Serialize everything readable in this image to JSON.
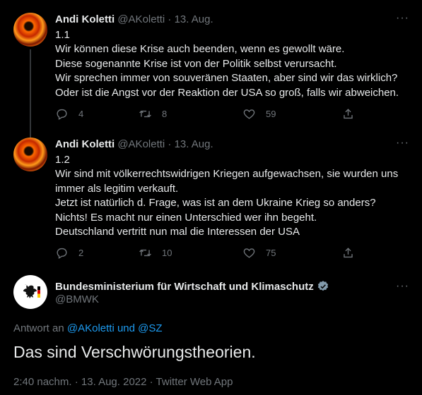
{
  "tweets": [
    {
      "name": "Andi Koletti",
      "handle": "@AKoletti",
      "sep": " · ",
      "date": "13. Aug.",
      "lines": [
        "1.1",
        "Wir können diese Krise auch beenden, wenn es gewollt wäre.",
        "Diese sogenannte Krise ist von der Politik selbst verursacht.",
        "Wir sprechen immer von souveränen Staaten, aber sind wir das wirklich?",
        "Oder ist die Angst vor der Reaktion der USA so groß, falls wir abweichen."
      ],
      "replies": "4",
      "retweets": "8",
      "likes": "59"
    },
    {
      "name": "Andi Koletti",
      "handle": "@AKoletti",
      "sep": " · ",
      "date": "13. Aug.",
      "lines": [
        "1.2",
        "Wir sind mit völkerrechtswidrigen Kriegen aufgewachsen, sie wurden uns",
        "immer als legitim verkauft.",
        "Jetzt ist natürlich d. Frage, was ist an dem Ukraine Krieg so anders?",
        "Nichts! Es macht nur einen Unterschied wer ihn begeht.",
        "Deutschland vertritt nun mal die Interessen der USA"
      ],
      "replies": "2",
      "retweets": "10",
      "likes": "75"
    }
  ],
  "main": {
    "name": "Bundesministerium für Wirtschaft und Klimaschutz",
    "handle": "@BMWK",
    "reply_prefix": "Antwort an ",
    "reply_user1": "@AKoletti",
    "reply_and": " und ",
    "reply_user2": "@SZ",
    "text": "Das sind Verschwörungstheorien.",
    "timestamp": "2:40 nachm. · 13. Aug. 2022 · Twitter Web App"
  },
  "more_label": "···",
  "colors": {
    "background": "#000000",
    "text": "#e7e9ea",
    "muted": "#71767b",
    "link": "#1d9bf0",
    "verified": "#829aab"
  },
  "icons": [
    "reply-icon",
    "retweet-icon",
    "like-icon",
    "share-icon",
    "more-icon",
    "verified-icon",
    "eagle-icon"
  ]
}
